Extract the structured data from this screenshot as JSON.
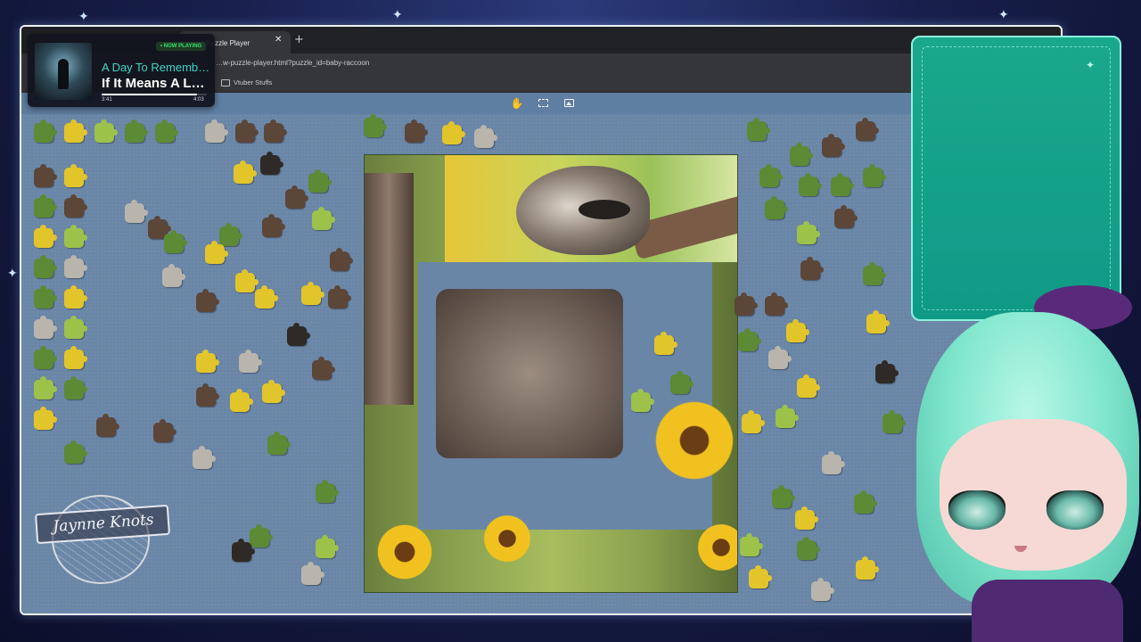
{
  "browser": {
    "tab_title": "…er Puzzle Player",
    "tab_close": "✕",
    "new_tab": "+",
    "url": "…w-puzzle-player.html?puzzle_id=baby-raccoon",
    "bookmark_folder": "Vtuber Stuffs"
  },
  "puzzle_toolbar": {
    "tools": [
      {
        "icon": "hand-icon",
        "glyph": "✋"
      },
      {
        "icon": "select-icon",
        "glyph": ""
      },
      {
        "icon": "image-icon",
        "glyph": ""
      }
    ],
    "background_color": "#6a86a6",
    "toolbar_color": "#5f7fa2"
  },
  "now_playing": {
    "badge": "• NOW PLAYING",
    "artist": "A Day To Rememb…",
    "title": "If It Means A L…",
    "elapsed": "3:41",
    "total": "4:03",
    "progress": 0.91,
    "accent_color": "#3fd3c8"
  },
  "logo": {
    "text": "Jaynne Knots"
  },
  "panel": {
    "color": "#1aa88c",
    "sparkle": "✦"
  },
  "stars": [
    "✦",
    "✦",
    "✦",
    "✦"
  ]
}
